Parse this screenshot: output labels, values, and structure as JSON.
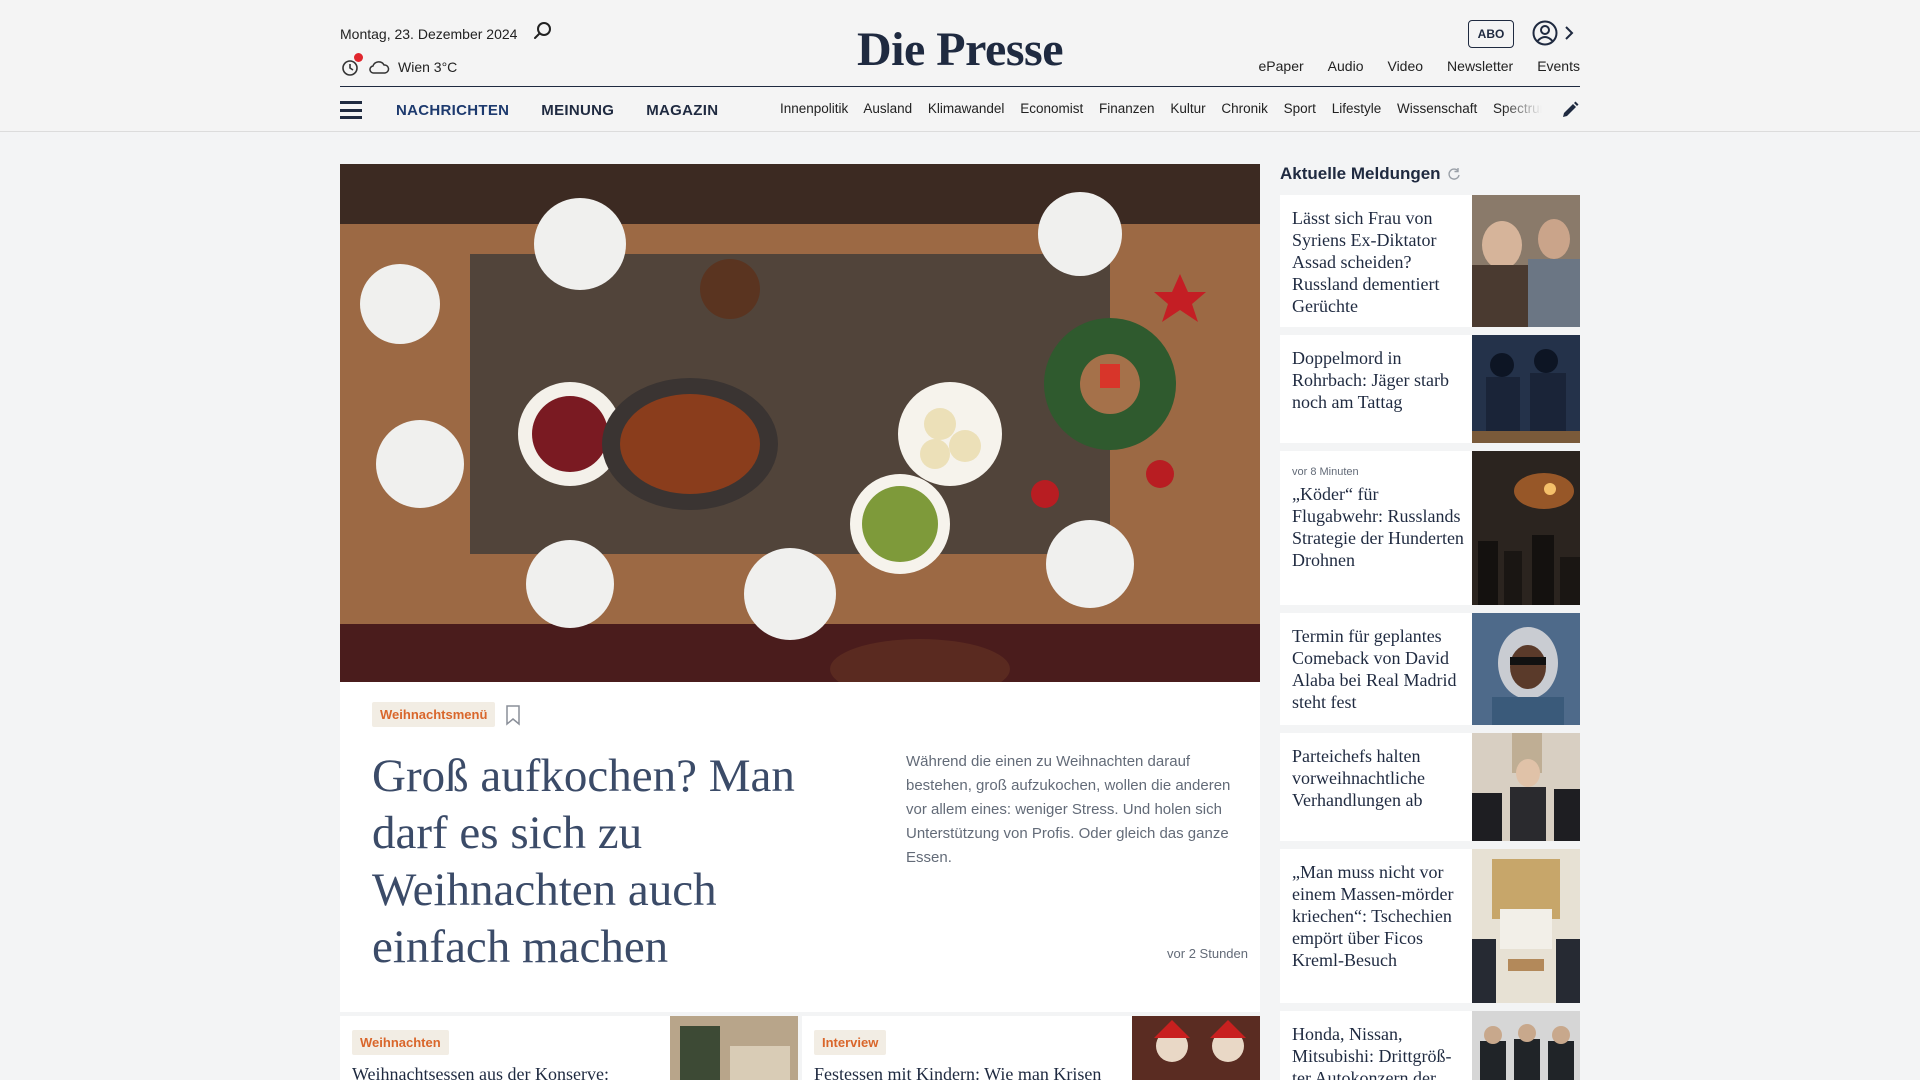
{
  "header": {
    "date": "Montag, 23. Dezember 2024",
    "weather": "Wien 3°C",
    "logo": "Die Presse",
    "abo": "ABO",
    "top_links": [
      "ePaper",
      "Audio",
      "Video",
      "Newsletter",
      "Events"
    ],
    "main_nav": [
      "NACHRICHTEN",
      "MEINUNG",
      "MAGAZIN"
    ],
    "sub_nav": [
      "Innenpolitik",
      "Ausland",
      "Klimawandel",
      "Economist",
      "Finanzen",
      "Kultur",
      "Chronik",
      "Sport",
      "Lifestyle",
      "Wissenschaft",
      "Spectrum"
    ]
  },
  "hero": {
    "tag": "Weihnachtsmenü",
    "title": "Groß aufkochen? Man darf es sich zu Weihnachten auch einfach machen",
    "teaser": "Während die einen zu Weihnachten darauf bestehen, groß aufzukochen, wollen die anderen vor allem eines: weniger Stress. Und holen sich Unterstützung von Profis. Oder gleich das ganze Essen.",
    "time": "vor 2 Stunden"
  },
  "cards": [
    {
      "tag": "Weihnachten",
      "title": "Weihnachtsessen aus der Konserve:"
    },
    {
      "tag": "Interview",
      "title": "Festessen mit Kindern: Wie man Krisen"
    }
  ],
  "sidebar": {
    "heading": "Aktuelle Meldungen",
    "items": [
      {
        "time": "",
        "title": "Lässt sich Frau von Syriens Ex-Diktator Assad scheiden? Russland dementiert Gerüchte"
      },
      {
        "time": "",
        "title": "Doppelmord in Rohrbach: Jäger starb noch am Tattag"
      },
      {
        "time": "vor 8 Minuten",
        "title": "„Köder“ für Flugabwehr: Russlands Strategie der Hunderten Drohnen"
      },
      {
        "time": "",
        "title": "Termin für geplantes Comeback von David Alaba bei Real Madrid steht fest"
      },
      {
        "time": "",
        "title": "Parteichefs halten vorweihnachtliche Verhandlungen ab"
      },
      {
        "time": "",
        "title": "„Man muss nicht vor einem Massen-mörder kriechen“: Tschechien empört über Ficos Kreml-Besuch"
      },
      {
        "time": "",
        "title": "Honda, Nissan, Mitsubishi: Drittgröß-ter Autokonzern der"
      }
    ]
  },
  "colors": {
    "navy": "#1f2a40",
    "tag_text": "#d9662b",
    "tag_bg": "#f2ede4",
    "headline": "#3b4b68"
  }
}
